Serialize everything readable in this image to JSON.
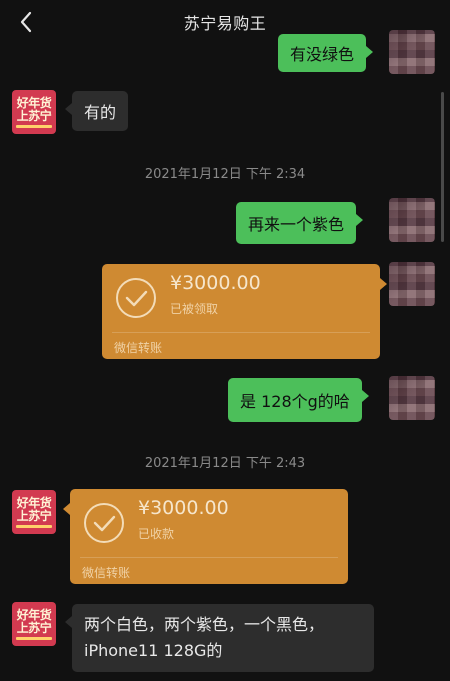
{
  "header": {
    "title": "苏宁易购王"
  },
  "avatar_logo": {
    "line1": "好年货",
    "line2": "上苏宁"
  },
  "messages": {
    "m1": "有没绿色",
    "m2": "有的",
    "ts1": "2021年1月12日 下午 2:34",
    "m3": "再来一个紫色",
    "t1": {
      "amount": "¥3000.00",
      "status": "已被领取",
      "footer": "微信转账"
    },
    "m4": "是 128个g的哈",
    "ts2": "2021年1月12日 下午 2:43",
    "t2": {
      "amount": "¥3000.00",
      "status": "已收款",
      "footer": "微信转账"
    },
    "m5": {
      "line1": "两个白色，两个紫色，一个黑色，",
      "line2": "iPhone11 128G的"
    }
  },
  "colors": {
    "background": "#111111",
    "sent_bubble": "#4cbf5a",
    "received_bubble": "#2d2d2d",
    "transfer": "#cf8a32",
    "logo": "#d23a50"
  },
  "icons": [
    "chevron-left-icon",
    "check-circle-icon"
  ]
}
